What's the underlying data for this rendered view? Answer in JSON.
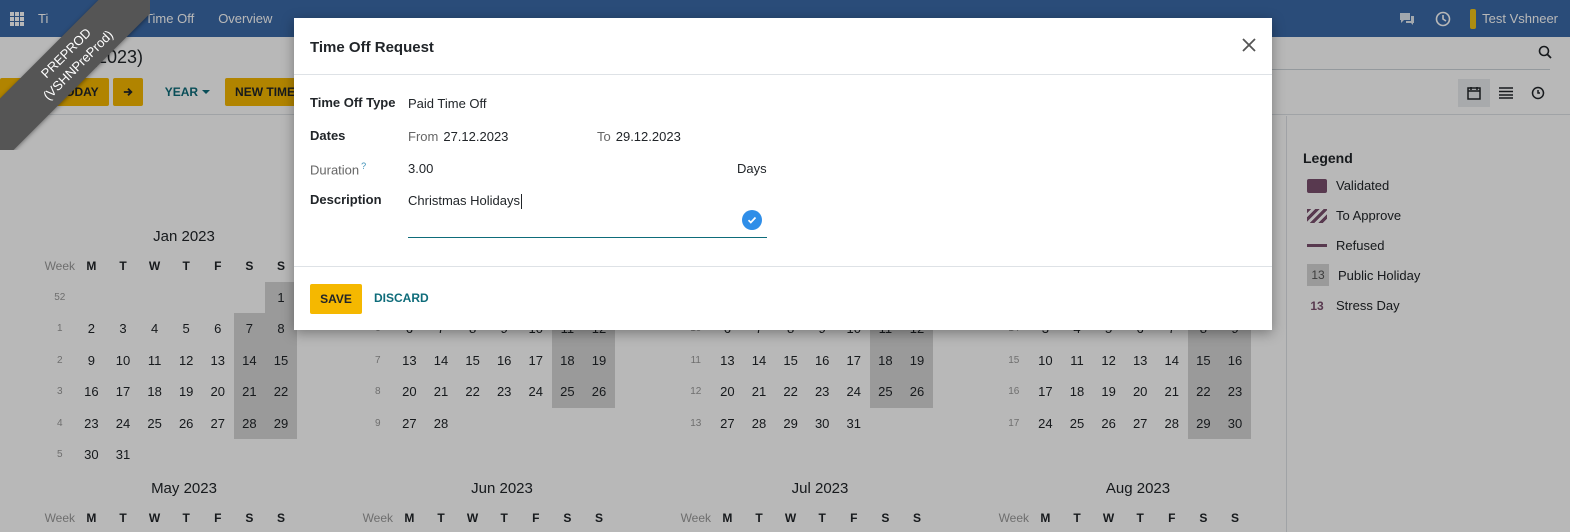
{
  "nav": {
    "app_short": "Ti",
    "links": [
      "My Time Off",
      "Overview"
    ],
    "user_name": "Test Vshneer"
  },
  "ribbon": {
    "line1": "PREPROD",
    "line2": "(VSHNPreProd)"
  },
  "control": {
    "breadcrumb": "ard (2023)",
    "today_label": "TODAY",
    "year_label": "YEAR",
    "new_label": "NEW TIME OFF"
  },
  "calendar": {
    "week_label": "Week",
    "weekdays": [
      "M",
      "T",
      "W",
      "T",
      "F",
      "S",
      "S"
    ],
    "months_top": [
      {
        "title": "Jan 2023",
        "rows": [
          [
            "52",
            "",
            "",
            "",
            "",
            "",
            "",
            "1"
          ],
          [
            "1",
            "2",
            "3",
            "4",
            "5",
            "6",
            "7",
            "8"
          ],
          [
            "2",
            "9",
            "10",
            "11",
            "12",
            "13",
            "14",
            "15"
          ],
          [
            "3",
            "16",
            "17",
            "18",
            "19",
            "20",
            "21",
            "22"
          ],
          [
            "4",
            "23",
            "24",
            "25",
            "26",
            "27",
            "28",
            "29"
          ],
          [
            "5",
            "30",
            "31",
            "",
            "",
            "",
            "",
            ""
          ]
        ]
      },
      {
        "title": "",
        "rows": [
          [
            "",
            "",
            "",
            "",
            "",
            "",
            "",
            ""
          ],
          [
            "6",
            "6",
            "7",
            "8",
            "9",
            "10",
            "11",
            "12"
          ],
          [
            "7",
            "13",
            "14",
            "15",
            "16",
            "17",
            "18",
            "19"
          ],
          [
            "8",
            "20",
            "21",
            "22",
            "23",
            "24",
            "25",
            "26"
          ],
          [
            "9",
            "27",
            "28",
            "",
            "",
            "",
            "",
            ""
          ],
          [
            "",
            "",
            "",
            "",
            "",
            "",
            "",
            ""
          ]
        ]
      },
      {
        "title": "",
        "rows": [
          [
            "",
            "",
            "",
            "",
            "",
            "",
            "",
            ""
          ],
          [
            "10",
            "6",
            "7",
            "8",
            "9",
            "10",
            "11",
            "12"
          ],
          [
            "11",
            "13",
            "14",
            "15",
            "16",
            "17",
            "18",
            "19"
          ],
          [
            "12",
            "20",
            "21",
            "22",
            "23",
            "24",
            "25",
            "26"
          ],
          [
            "13",
            "27",
            "28",
            "29",
            "30",
            "31",
            "",
            ""
          ],
          [
            "",
            "",
            "",
            "",
            "",
            "",
            "",
            ""
          ]
        ]
      },
      {
        "title": "",
        "rows": [
          [
            "",
            "",
            "",
            "",
            "",
            "",
            "",
            ""
          ],
          [
            "14",
            "3",
            "4",
            "5",
            "6",
            "7",
            "8",
            "9"
          ],
          [
            "15",
            "10",
            "11",
            "12",
            "13",
            "14",
            "15",
            "16"
          ],
          [
            "16",
            "17",
            "18",
            "19",
            "20",
            "21",
            "22",
            "23"
          ],
          [
            "17",
            "24",
            "25",
            "26",
            "27",
            "28",
            "29",
            "30"
          ],
          [
            "",
            "",
            "",
            "",
            "",
            "",
            "",
            ""
          ]
        ]
      }
    ],
    "months_bottom": [
      "May 2023",
      "Jun 2023",
      "Jul 2023",
      "Aug 2023"
    ]
  },
  "legend": {
    "title": "Legend",
    "items": [
      {
        "label": "Validated"
      },
      {
        "label": "To Approve"
      },
      {
        "label": "Refused"
      },
      {
        "label": "Public Holiday",
        "swatch_text": "13"
      },
      {
        "label": "Stress Day",
        "swatch_text": "13"
      }
    ]
  },
  "modal": {
    "title": "Time Off Request",
    "type_label": "Time Off Type",
    "type_value": "Paid Time Off",
    "dates_label": "Dates",
    "from_label": "From",
    "from_value": "27.12.2023",
    "to_label": "To",
    "to_value": "29.12.2023",
    "duration_label": "Duration",
    "duration_help": "?",
    "duration_value": "3.00",
    "duration_unit": "Days",
    "description_label": "Description",
    "description_value": "Christmas Holidays",
    "save_label": "SAVE",
    "discard_label": "DISCARD"
  },
  "colors": {
    "nav_bg": "#3b6aa8",
    "primary": "#f5b800",
    "secondary_text": "#0e6c7a",
    "leave_color": "#7b4f6e"
  }
}
